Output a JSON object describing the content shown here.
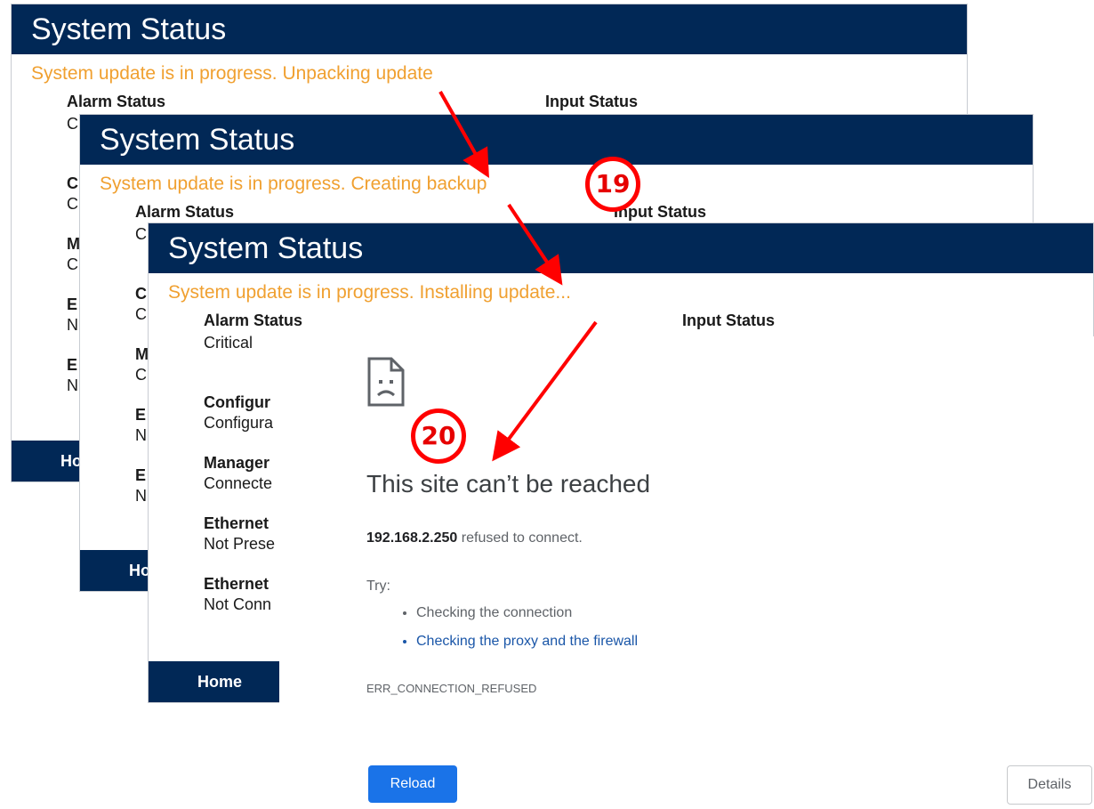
{
  "panels": [
    {
      "title": "System Status",
      "progress": "System update is in progress. Unpacking update",
      "alarm_head": "Alarm Status",
      "input_head": "Input Status",
      "stats": [
        {
          "label": "",
          "value": "C"
        },
        {
          "label": "C",
          "value": "C"
        },
        {
          "label": "M",
          "value": "C"
        },
        {
          "label": "E",
          "value": "N"
        },
        {
          "label": "E",
          "value": "N"
        }
      ],
      "home": "Home"
    },
    {
      "title": "System Status",
      "progress": "System update is in progress. Creating backup",
      "alarm_head": "Alarm Status",
      "input_head": "Input Status",
      "stats": [
        {
          "label": "",
          "value": "C"
        },
        {
          "label": "C",
          "value": "C"
        },
        {
          "label": "M",
          "value": "C"
        },
        {
          "label": "E",
          "value": "N"
        },
        {
          "label": "E",
          "value": "N"
        }
      ],
      "home": "Home"
    },
    {
      "title": "System Status",
      "progress": "System update is in progress. Installing update...",
      "alarm_head": "Alarm Status",
      "input_head": "Input Status",
      "stats": [
        {
          "label": "",
          "value": "Critical"
        },
        {
          "label": "Configur",
          "value": "Configura"
        },
        {
          "label": "Manager",
          "value": "Connecte"
        },
        {
          "label": "Ethernet",
          "value": "Not Prese"
        },
        {
          "label": "Ethernet",
          "value": "Not Conn"
        }
      ],
      "home": "Home"
    }
  ],
  "error_page": {
    "icon": "sad-page-icon",
    "headline": "This site can’t be reached",
    "host": "192.168.2.250",
    "message": "refused to connect.",
    "try_label": "Try:",
    "suggestions": [
      "Checking the connection",
      "Checking the proxy and the firewall"
    ],
    "error_code": "ERR_CONNECTION_REFUSED",
    "reload_label": "Reload",
    "details_label": "Details"
  },
  "annotations": {
    "step_a": "19",
    "step_b": "20",
    "color": "#ff0000"
  },
  "colors": {
    "header_navy": "#012856",
    "progress_orange": "#f0a030",
    "reload_blue": "#1a73e8",
    "link_blue": "#1a56a8"
  }
}
